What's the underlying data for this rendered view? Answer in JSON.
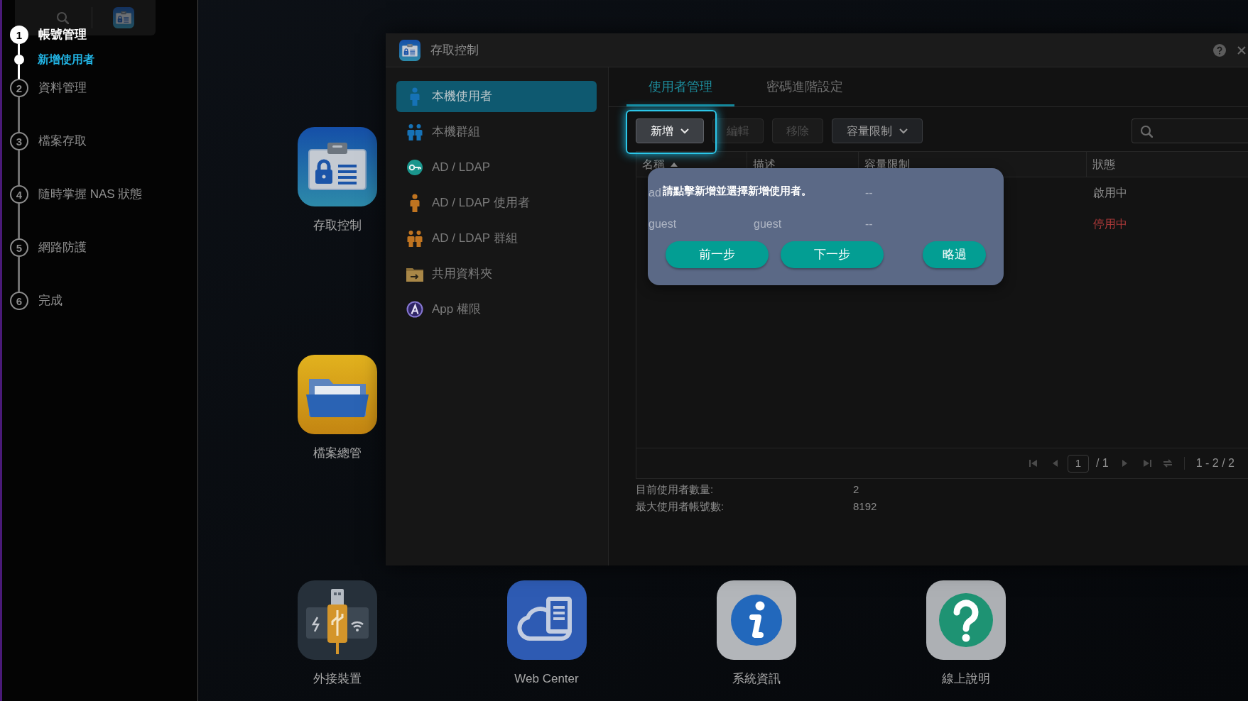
{
  "sidebar": {
    "steps": [
      {
        "number": "1",
        "label": "帳號管理",
        "selected": true,
        "children": [
          {
            "label": "新增使用者",
            "selected": true
          }
        ]
      },
      {
        "number": "2",
        "label": "資料管理",
        "selected": false
      },
      {
        "number": "3",
        "label": "檔案存取",
        "selected": false
      },
      {
        "number": "4",
        "label": "隨時掌握 NAS 狀態",
        "selected": false
      },
      {
        "number": "5",
        "label": "網路防護",
        "selected": false
      },
      {
        "number": "6",
        "label": "完成",
        "selected": false
      }
    ]
  },
  "desktop_icons": [
    {
      "label": "存取控制",
      "kind": "access"
    },
    {
      "label": "檔案總管",
      "kind": "files"
    },
    {
      "label": "外接裝置",
      "kind": "usb"
    },
    {
      "label": "Web Center",
      "kind": "web"
    },
    {
      "label": "系統資訊",
      "kind": "info"
    },
    {
      "label": "線上說明",
      "kind": "help"
    }
  ],
  "window": {
    "title": "存取控制",
    "nav": [
      {
        "label": "本機使用者",
        "kind": "user",
        "selected": true
      },
      {
        "label": "本機群組",
        "kind": "group",
        "selected": false
      },
      {
        "label": "AD / LDAP",
        "kind": "key",
        "selected": false
      },
      {
        "label": "AD / LDAP 使用者",
        "kind": "ldap-user",
        "selected": false
      },
      {
        "label": "AD / LDAP 群組",
        "kind": "ldap-group",
        "selected": false
      },
      {
        "label": "共用資料夾",
        "kind": "folder",
        "selected": false
      },
      {
        "label": "App 權限",
        "kind": "app",
        "selected": false
      }
    ],
    "tabs": [
      {
        "label": "使用者管理",
        "selected": true
      },
      {
        "label": "密碼進階設定",
        "selected": false
      }
    ],
    "toolbar": {
      "buttons": [
        {
          "label": "新增",
          "dropdown": true,
          "disabled": false,
          "highlighted": true
        },
        {
          "label": "編輯",
          "dropdown": false,
          "disabled": true,
          "highlighted": false
        },
        {
          "label": "移除",
          "dropdown": false,
          "disabled": true,
          "highlighted": false
        },
        {
          "label": "容量限制",
          "dropdown": true,
          "disabled": false,
          "highlighted": false
        }
      ]
    },
    "table": {
      "columns": [
        {
          "label": "名稱",
          "sorted_ascending": true
        },
        {
          "label": "描述",
          "sorted_ascending": false
        },
        {
          "label": "容量限制",
          "sorted_ascending": false
        },
        {
          "label": "狀態",
          "sorted_ascending": false
        }
      ],
      "rows": [
        {
          "name": "ad",
          "quota": "--",
          "status": "啟用中",
          "enabled": true
        },
        {
          "name": "guest",
          "description": "guest",
          "quota": "--",
          "status": "停用中",
          "enabled": false
        }
      ]
    },
    "pagination": {
      "page": "1",
      "total": "/ 1",
      "range": "1 - 2 / 2"
    },
    "summary": [
      {
        "label": "目前使用者數量:",
        "value": "2"
      },
      {
        "label": "最大使用者帳號數:",
        "value": "8192"
      }
    ]
  },
  "tour_dialog": {
    "message": "請點擊新增並選擇新增使用者。",
    "buttons": [
      "前一步",
      "下一步",
      "略過"
    ]
  }
}
